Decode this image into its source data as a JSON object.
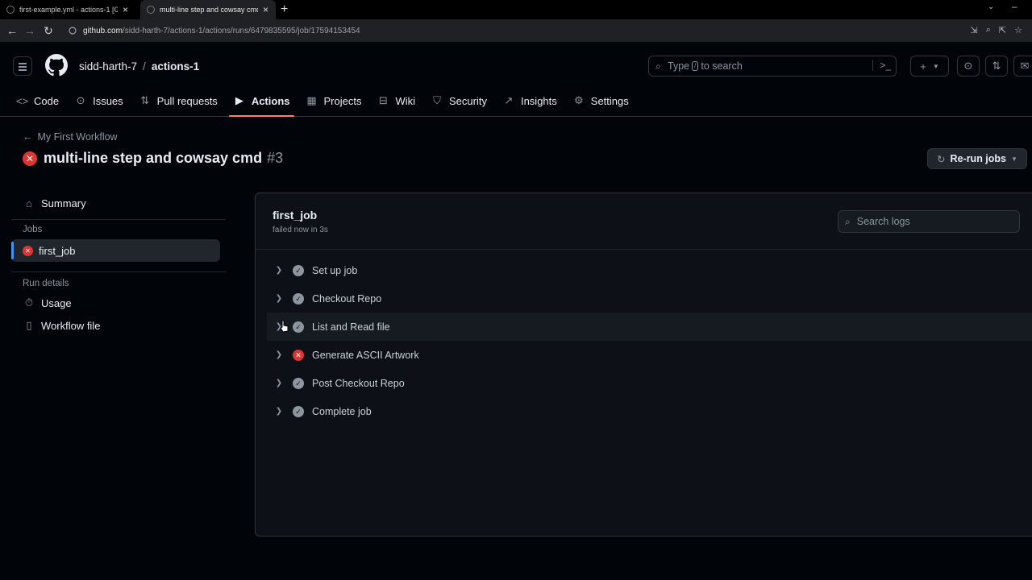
{
  "browser": {
    "tabs": [
      {
        "title": "first-example.yml - actions-1 [Gi"
      },
      {
        "title": "multi-line step and cowsay cmd"
      }
    ],
    "url_host": "github.com",
    "url_path": "/sidd-harth-7/actions-1/actions/runs/6479835595/job/17594153454"
  },
  "header": {
    "owner": "sidd-harth-7",
    "separator": "/",
    "repo": "actions-1",
    "search_placeholder_a": "Type",
    "search_key": "/",
    "search_placeholder_b": "to search"
  },
  "repo_nav": [
    {
      "label": "Code",
      "icon": "code-icon"
    },
    {
      "label": "Issues",
      "icon": "issue-icon"
    },
    {
      "label": "Pull requests",
      "icon": "pull-request-icon"
    },
    {
      "label": "Actions",
      "icon": "play-icon",
      "active": true
    },
    {
      "label": "Projects",
      "icon": "table-icon"
    },
    {
      "label": "Wiki",
      "icon": "book-icon"
    },
    {
      "label": "Security",
      "icon": "shield-icon"
    },
    {
      "label": "Insights",
      "icon": "graph-icon"
    },
    {
      "label": "Settings",
      "icon": "gear-icon"
    }
  ],
  "run": {
    "back_label": "My First Workflow",
    "title": "multi-line step and cowsay cmd",
    "number": "#3",
    "status": "failed",
    "rerun_label": "Re-run jobs"
  },
  "sidebar": {
    "summary": "Summary",
    "jobs_heading": "Jobs",
    "job": "first_job",
    "run_details_heading": "Run details",
    "usage": "Usage",
    "workflow_file": "Workflow file"
  },
  "job": {
    "name": "first_job",
    "meta": "failed now in 3s",
    "search_placeholder": "Search logs",
    "steps": [
      {
        "label": "Set up job",
        "status": "success"
      },
      {
        "label": "Checkout Repo",
        "status": "success"
      },
      {
        "label": "List and Read file",
        "status": "success"
      },
      {
        "label": "Generate ASCII Artwork",
        "status": "failure"
      },
      {
        "label": "Post Checkout Repo",
        "status": "success"
      },
      {
        "label": "Complete job",
        "status": "success"
      }
    ]
  },
  "colors": {
    "background": "#010409",
    "panel": "#0d1117",
    "border": "#30363d",
    "accent_underline": "#f78166",
    "failure": "#da3633",
    "selection_bar": "#4493f8"
  }
}
